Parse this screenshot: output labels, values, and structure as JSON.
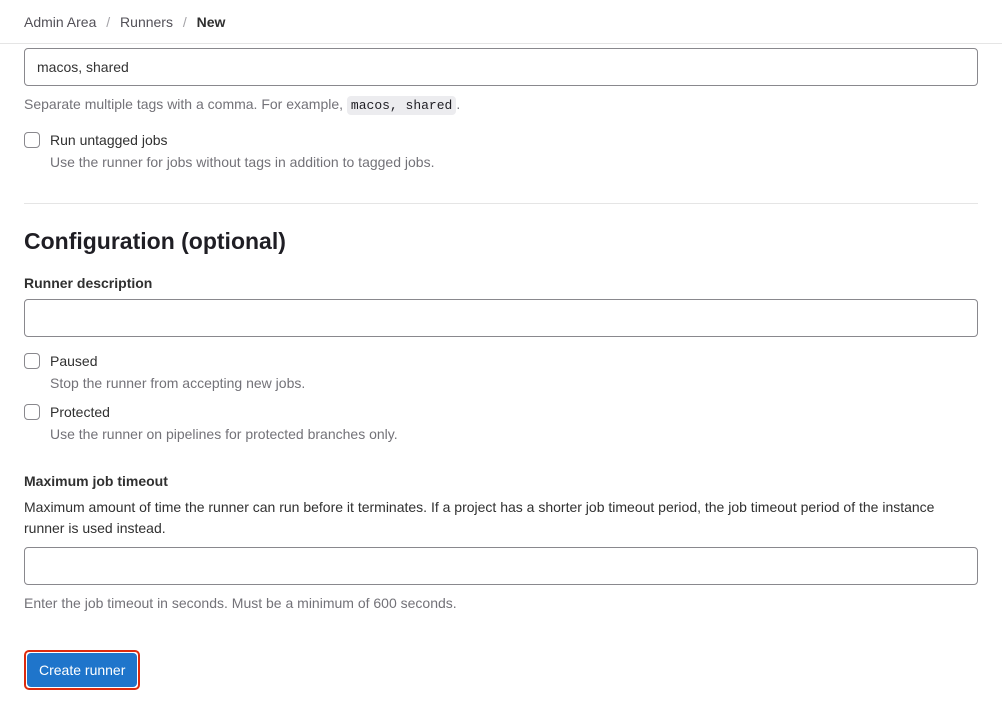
{
  "breadcrumbs": {
    "items": [
      "Admin Area",
      "Runners"
    ],
    "current": "New"
  },
  "tags": {
    "value": "macos, shared",
    "help_prefix": "Separate multiple tags with a comma. For example, ",
    "help_code": "macos, shared",
    "help_suffix": "."
  },
  "untagged": {
    "label": "Run untagged jobs",
    "desc": "Use the runner for jobs without tags in addition to tagged jobs."
  },
  "config": {
    "heading": "Configuration (optional)",
    "description_label": "Runner description",
    "description_value": "",
    "paused": {
      "label": "Paused",
      "desc": "Stop the runner from accepting new jobs."
    },
    "protected": {
      "label": "Protected",
      "desc": "Use the runner on pipelines for protected branches only."
    },
    "timeout": {
      "label": "Maximum job timeout",
      "desc": "Maximum amount of time the runner can run before it terminates. If a project has a shorter job timeout period, the job timeout period of the instance runner is used instead.",
      "value": "",
      "help": "Enter the job timeout in seconds. Must be a minimum of 600 seconds."
    }
  },
  "actions": {
    "submit": "Create runner"
  }
}
